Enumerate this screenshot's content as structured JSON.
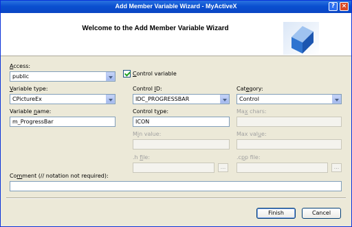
{
  "window": {
    "title": "Add Member Variable Wizard - MyActiveX",
    "help_label": "?",
    "close_label": "×"
  },
  "header": {
    "title": "Welcome to the Add Member Variable Wizard"
  },
  "access": {
    "label_u": "A",
    "label_rest": "ccess:",
    "value": "public"
  },
  "control_variable": {
    "label_u": "C",
    "label_rest": "ontrol variable",
    "checked": true
  },
  "variable_type": {
    "label_u": "V",
    "label_rest": "ariable type:",
    "value": "CPictureEx"
  },
  "control_id": {
    "label_pre": "Control ",
    "label_u": "I",
    "label_rest": "D:",
    "value": "IDC_PROGRESSBAR"
  },
  "category": {
    "label_pre": "Cat",
    "label_u": "e",
    "label_rest": "gory:",
    "value": "Control"
  },
  "variable_name": {
    "label_pre": "Variable ",
    "label_u": "n",
    "label_rest": "ame:",
    "value": "m_ProgressBar"
  },
  "control_type": {
    "label_pre": "Control t",
    "label_u": "y",
    "label_rest": "pe:",
    "value": "ICON"
  },
  "max_chars": {
    "label_pre": "Ma",
    "label_u": "x",
    "label_rest": " chars:",
    "value": ""
  },
  "min_value": {
    "label_pre": "M",
    "label_u": "i",
    "label_rest": "n value:",
    "value": ""
  },
  "max_value": {
    "label_pre": "Max val",
    "label_u": "u",
    "label_rest": "e:",
    "value": ""
  },
  "h_file": {
    "label_pre": ".h ",
    "label_u": "f",
    "label_rest": "ile:",
    "value": "",
    "browse_label": "..."
  },
  "cpp_file": {
    "label_pre": ".c",
    "label_u": "p",
    "label_rest": "p file:",
    "value": "",
    "browse_label": "..."
  },
  "comment": {
    "label_pre": "Co",
    "label_u": "m",
    "label_rest": "ment (// notation not required):",
    "value": ""
  },
  "buttons": {
    "finish": "Finish",
    "cancel": "Cancel"
  },
  "colors": {
    "titlebar": "#0a4fd0",
    "dialog_bg": "#ece9d8",
    "field_border": "#7f9db9",
    "disabled_text": "#a0a0a0"
  },
  "icons": {
    "logo": "blue-cube-icon",
    "checkbox": "checkmark-icon",
    "dropdown": "chevron-down-icon"
  }
}
